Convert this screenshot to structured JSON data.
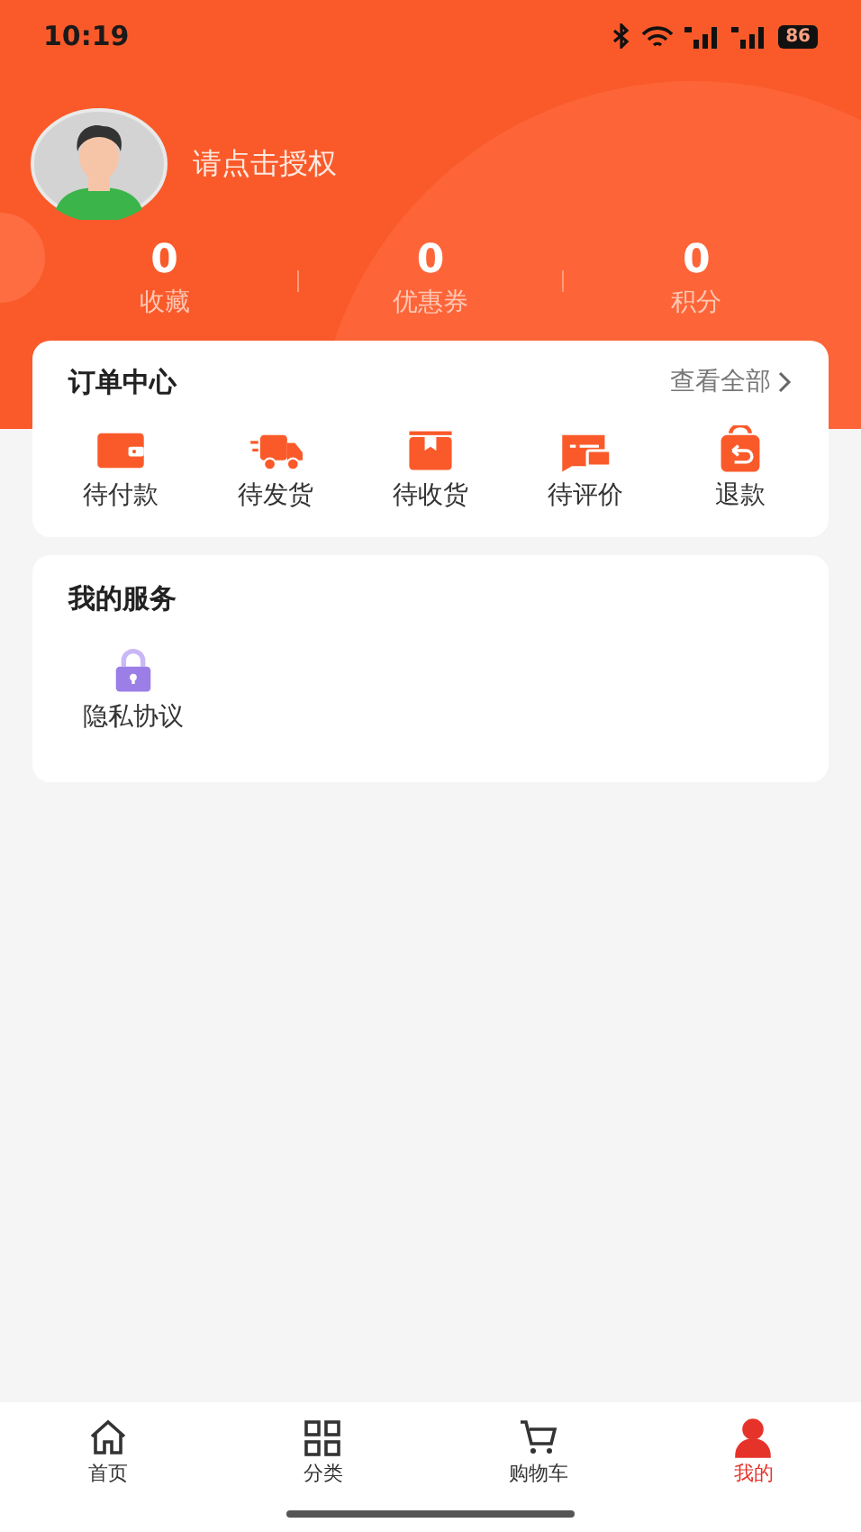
{
  "status_bar": {
    "time": "10:19",
    "battery": "86"
  },
  "profile": {
    "name": "请点击授权"
  },
  "stats": [
    {
      "value": "0",
      "label": "收藏"
    },
    {
      "value": "0",
      "label": "优惠券"
    },
    {
      "value": "0",
      "label": "积分"
    }
  ],
  "orders": {
    "title": "订单中心",
    "view_all": "查看全部",
    "items": [
      {
        "kind": "wallet",
        "label": "待付款"
      },
      {
        "kind": "truck",
        "label": "待发货"
      },
      {
        "kind": "box",
        "label": "待收货"
      },
      {
        "kind": "review",
        "label": "待评价"
      },
      {
        "kind": "refund",
        "label": "退款"
      }
    ]
  },
  "services": {
    "title": "我的服务",
    "items": [
      {
        "kind": "lock",
        "label": "隐私协议"
      }
    ]
  },
  "tab_bar": [
    {
      "kind": "home",
      "label": "首页",
      "selected": false
    },
    {
      "kind": "grid",
      "label": "分类",
      "selected": false
    },
    {
      "kind": "cart",
      "label": "购物车",
      "selected": false
    },
    {
      "kind": "user",
      "label": "我的",
      "selected": true
    }
  ]
}
